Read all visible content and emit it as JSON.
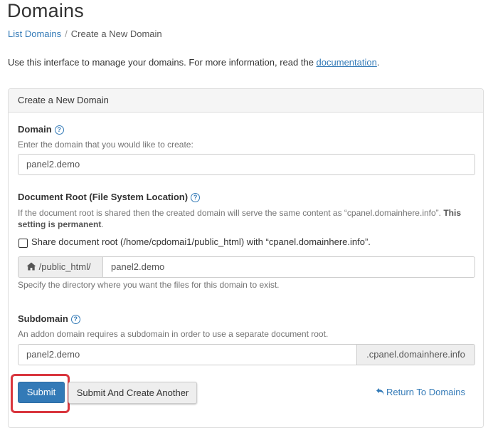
{
  "header": {
    "title": "Domains"
  },
  "breadcrumb": {
    "link": "List Domains",
    "separator": "/",
    "current": "Create a New Domain"
  },
  "intro": {
    "text": "Use this interface to manage your domains. For more information, read the ",
    "link": "documentation",
    "end": "."
  },
  "panel": {
    "heading": "Create a New Domain"
  },
  "domain": {
    "label": "Domain",
    "hint": "Enter the domain that you would like to create:",
    "value": "panel2.demo"
  },
  "docroot": {
    "label": "Document Root (File System Location)",
    "hint_pre": "If the document root is shared then the created domain will serve the same content as “cpanel.domainhere.info”.",
    "hint_bold_1": "This",
    "hint_bold_2": "setting is permanent",
    "hint_end": ".",
    "share_label": "Share document root (/home/cpdomai1/public_html) with “cpanel.domainhere.info”.",
    "share_checked": false,
    "prefix": "/public_html/",
    "value": "panel2.demo",
    "specify_hint": "Specify the directory where you want the files for this domain to exist."
  },
  "subdomain": {
    "label": "Subdomain",
    "hint": "An addon domain requires a subdomain in order to use a separate document root.",
    "value": "panel2.demo",
    "suffix": ".cpanel.domainhere.info"
  },
  "actions": {
    "submit": "Submit",
    "submit_another": "Submit And Create Another",
    "return": "Return To Domains"
  },
  "colors": {
    "primary": "#337ab7",
    "highlight": "#d9363e"
  },
  "icons": {
    "help": "question-circle-icon",
    "home": "home-icon",
    "return": "undo-arrow-icon"
  }
}
